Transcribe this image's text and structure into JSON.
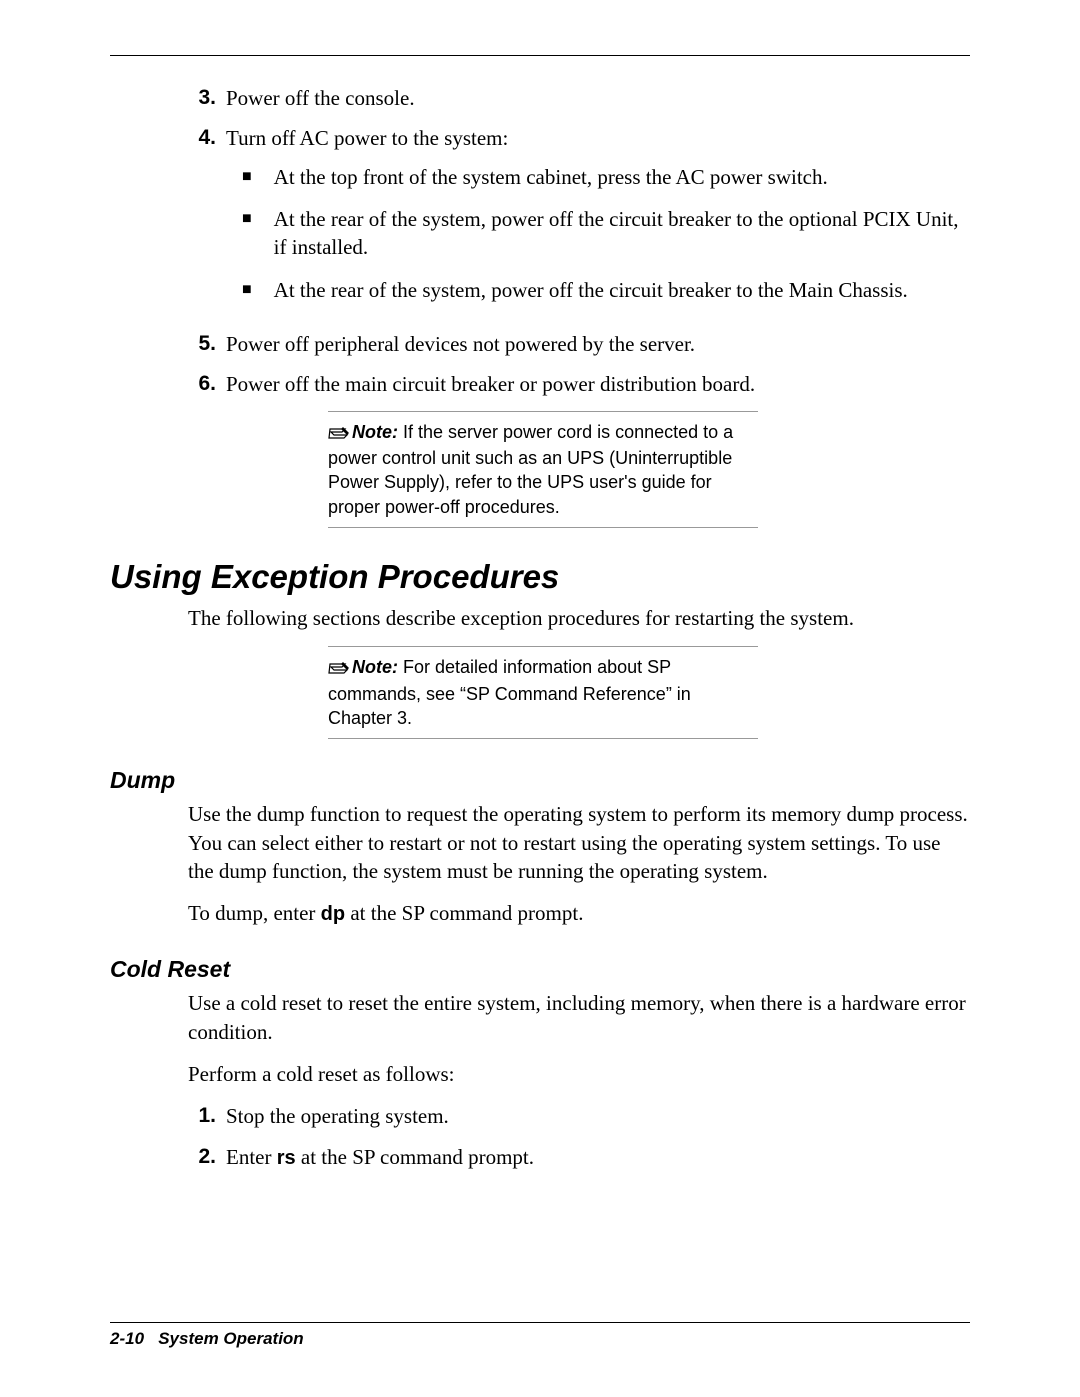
{
  "steps": {
    "s3": {
      "num": "3.",
      "text": "Power off the console."
    },
    "s4": {
      "num": "4.",
      "intro": "Turn off AC power to the system:",
      "bullets": [
        "At the top front of the system cabinet, press the AC power switch.",
        "At the rear of the system, power off the circuit breaker to the optional PCIX Unit, if installed.",
        "At the rear of the system, power off the circuit breaker to the Main Chassis."
      ]
    },
    "s5": {
      "num": "5.",
      "text": "Power off peripheral devices not powered by the server."
    },
    "s6": {
      "num": "6.",
      "text": "Power off the main circuit breaker or power distribution board."
    }
  },
  "note1": {
    "label": "Note:",
    "text": " If the server power cord is connected to a power control unit such as an UPS (Uninterruptible Power Supply), refer to the UPS user's guide for proper power-off procedures."
  },
  "section_heading": "Using Exception Procedures",
  "section_intro": "The following sections describe exception procedures for restarting the system.",
  "note2": {
    "label": "Note:",
    "text": "  For detailed information about SP commands, see “SP Command Reference” in Chapter 3."
  },
  "dump": {
    "heading": "Dump",
    "p1": "Use the dump function to request the operating system to perform its memory dump process. You can select either to restart or not to restart using the operating system settings. To use the dump function, the system must be running the operating system.",
    "p2_pre": "To dump, enter ",
    "p2_cmd": "dp",
    "p2_post": " at the SP command prompt."
  },
  "cold": {
    "heading": "Cold Reset",
    "p1": "Use a cold reset to reset the entire system, including memory, when there is a hardware error condition.",
    "p2": "Perform a cold reset as follows:",
    "s1": {
      "num": "1.",
      "text": "Stop the operating system."
    },
    "s2": {
      "num": "2.",
      "pre": "Enter ",
      "cmd": "rs",
      "post": " at the SP command prompt."
    }
  },
  "footer": {
    "page": "2-10",
    "title": "System Operation"
  }
}
